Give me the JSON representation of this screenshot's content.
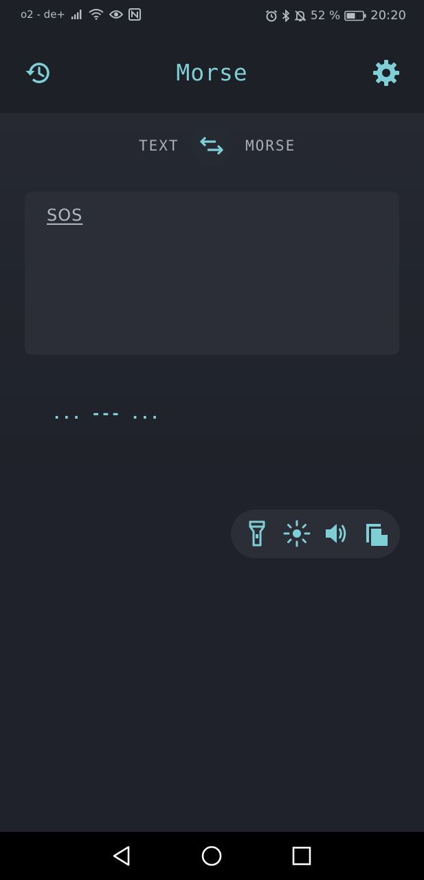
{
  "status_bar": {
    "carrier": "o2 - de+",
    "battery_percent": "52 %",
    "time": "20:20",
    "icons": [
      "signal-icon",
      "wifi-icon",
      "eye-icon",
      "nfc-icon",
      "alarm-icon",
      "bluetooth-icon",
      "notifications-off-icon",
      "battery-icon"
    ]
  },
  "app_bar": {
    "title": "Morse",
    "history_icon": "history-icon",
    "settings_icon": "gear-icon"
  },
  "switcher": {
    "from_label": "TEXT",
    "to_label": "MORSE",
    "swap_icon": "swap-arrows-icon"
  },
  "input": {
    "value": "SOS"
  },
  "output": {
    "morse": "... --- ..."
  },
  "actions": [
    {
      "name": "flashlight",
      "icon": "flashlight-icon"
    },
    {
      "name": "flash-screen",
      "icon": "brightness-icon"
    },
    {
      "name": "sound",
      "icon": "volume-icon"
    },
    {
      "name": "copy",
      "icon": "copy-icon"
    }
  ],
  "colors": {
    "accent": "#7fd0d6",
    "background": "#1f222a",
    "card": "#2b2e37",
    "app_bar": "#1d2027"
  }
}
